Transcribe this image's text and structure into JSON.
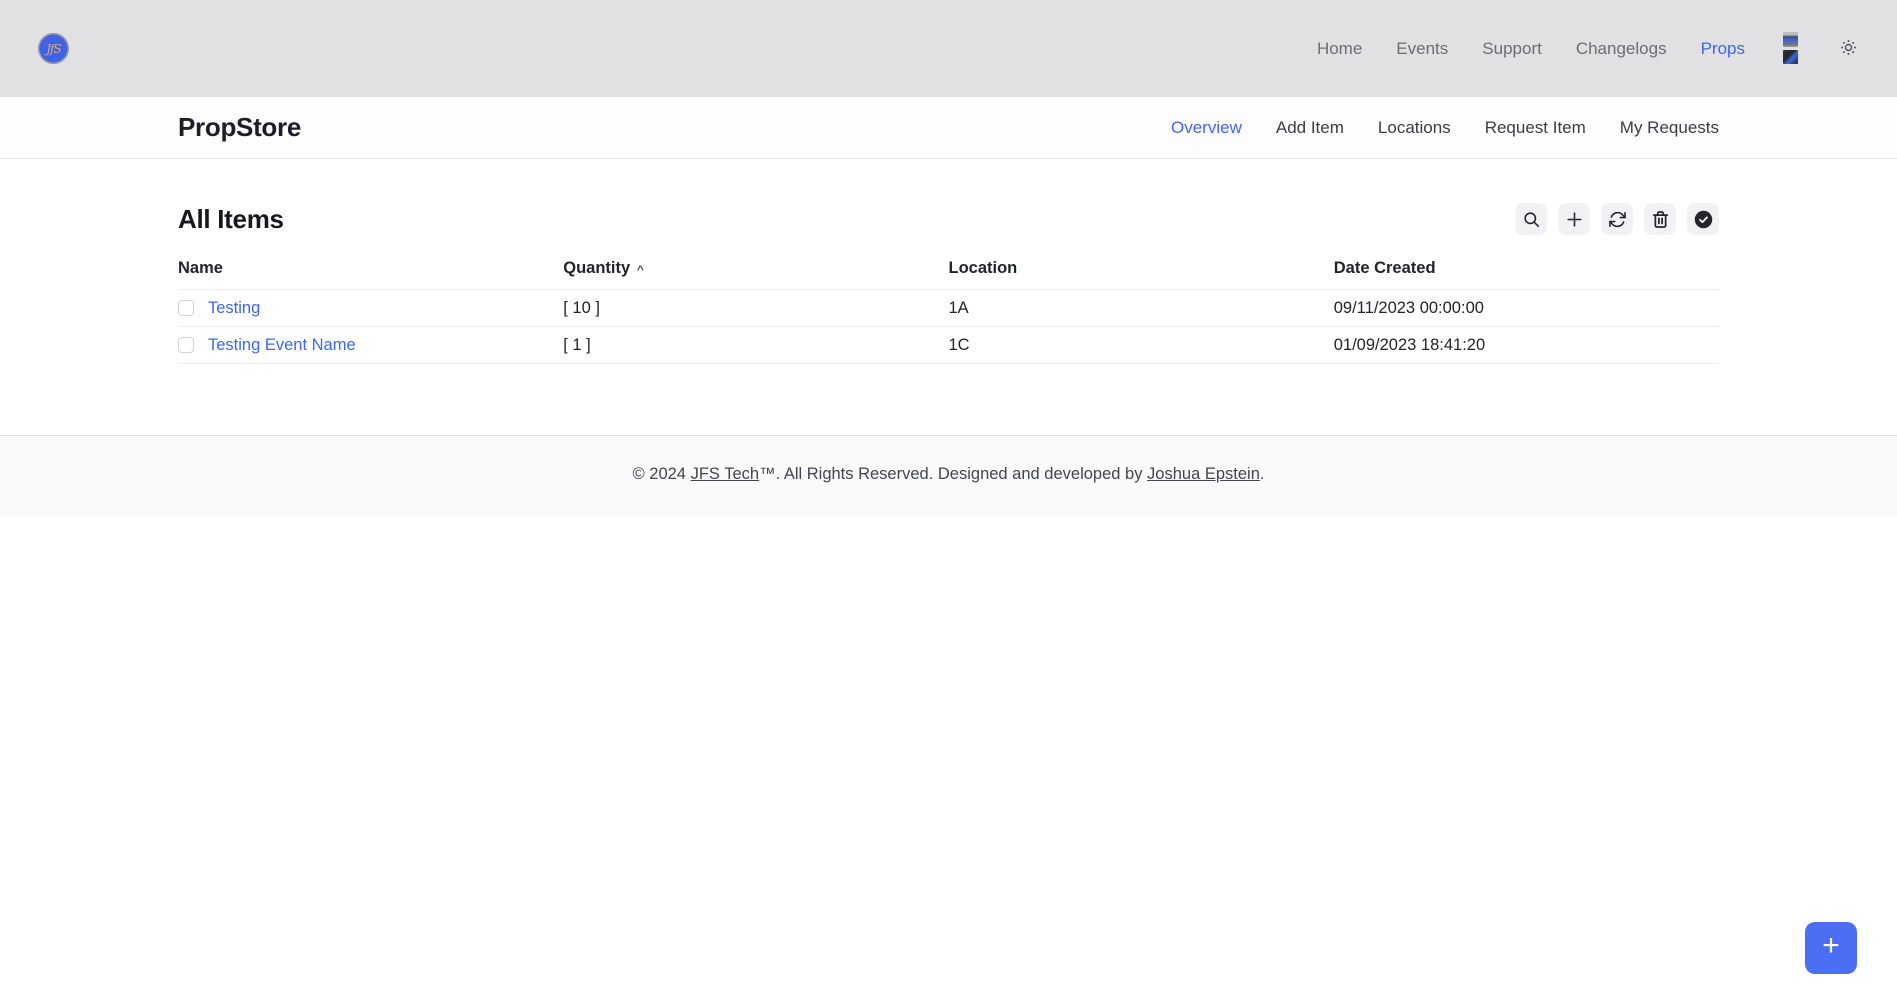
{
  "topnav": {
    "logo_text": "JfS",
    "links": [
      {
        "label": "Home",
        "active": false
      },
      {
        "label": "Events",
        "active": false
      },
      {
        "label": "Support",
        "active": false
      },
      {
        "label": "Changelogs",
        "active": false
      },
      {
        "label": "Props",
        "active": true
      }
    ],
    "theme_icon": "sun-icon",
    "avatar_icon": "user-avatar-image"
  },
  "subnav": {
    "title": "PropStore",
    "tabs": [
      {
        "label": "Overview",
        "active": true
      },
      {
        "label": "Add Item",
        "active": false
      },
      {
        "label": "Locations",
        "active": false
      },
      {
        "label": "Request Item",
        "active": false
      },
      {
        "label": "My Requests",
        "active": false
      }
    ]
  },
  "main": {
    "heading": "All Items",
    "toolbar": {
      "icons": [
        "search-icon",
        "plus-icon",
        "refresh-icon",
        "trash-icon",
        "circle-check-icon"
      ]
    },
    "table": {
      "columns": [
        "Name",
        "Quantity",
        "Location",
        "Date Created"
      ],
      "sort_column": "Quantity",
      "sort_indicator": "^",
      "rows": [
        {
          "name": "Testing",
          "quantity": "[ 10 ]",
          "location": "1A",
          "date_created": "09/11/2023 00:00:00"
        },
        {
          "name": "Testing Event Name",
          "quantity": "[ 1 ]",
          "location": "1C",
          "date_created": "01/09/2023 18:41:20"
        }
      ]
    }
  },
  "footer": {
    "prefix": "© 2024 ",
    "link1": "JFS Tech",
    "middle": "™. All Rights Reserved. Designed and developed by ",
    "link2": "Joshua Epstein",
    "suffix": "."
  },
  "fab": {
    "icon": "plus-icon",
    "label": "+"
  },
  "colors": {
    "accent": "#4c6ef5",
    "link_blue": "#3e66f3",
    "topnav_bg": "#e1e1e3",
    "footer_bg": "#fafafb",
    "logo_bg": "#3f62e6",
    "logo_text": "#d2b071",
    "dark_icon": "#25262b"
  }
}
